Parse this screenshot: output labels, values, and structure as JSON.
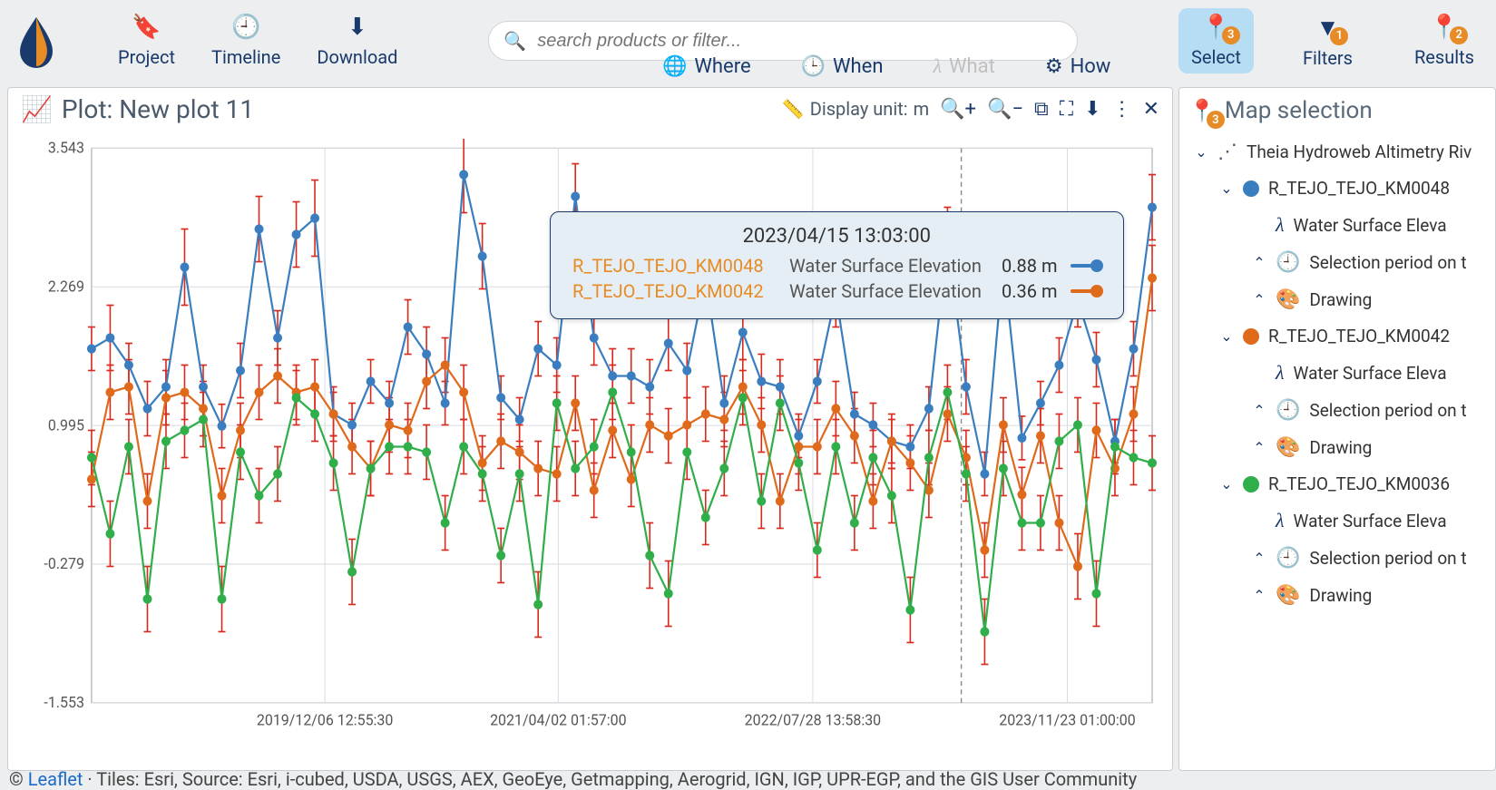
{
  "header": {
    "nav": [
      {
        "icon": "bookmark",
        "label": "Project"
      },
      {
        "icon": "clock",
        "label": "Timeline"
      },
      {
        "icon": "download",
        "label": "Download"
      }
    ],
    "search_placeholder": "search products or filter...",
    "tabs": [
      {
        "icon": "globe",
        "label": "Where",
        "active": true
      },
      {
        "icon": "clock",
        "label": "When",
        "active": true
      },
      {
        "icon": "lambda",
        "label": "What",
        "active": false
      },
      {
        "icon": "sliders",
        "label": "How",
        "active": true
      }
    ],
    "right": [
      {
        "icon": "markers",
        "label": "Select",
        "badge": 3,
        "active": true
      },
      {
        "icon": "funnel",
        "label": "Filters",
        "badge": 1
      },
      {
        "icon": "pin",
        "label": "Results",
        "badge": 2
      }
    ]
  },
  "plot": {
    "title": "Plot: New plot 11",
    "unit_label": "Display unit:",
    "unit_value": "m",
    "actions": [
      "zoom-in",
      "zoom-out",
      "crop",
      "scan",
      "download",
      "more",
      "close"
    ],
    "yticks": [
      -1.553,
      -0.279,
      0.995,
      2.269,
      3.543
    ],
    "xticks": [
      "2019/12/06 12:55:30",
      "2021/04/02 01:57:00",
      "2022/07/28 13:58:30",
      "2023/11/23 01:00:00"
    ],
    "tooltip": {
      "timestamp": "2023/04/15 13:03:00",
      "rows": [
        {
          "series": "R_TEJO_TEJO_KM0048",
          "var": "Water Surface Elevation",
          "value": "0.88",
          "unit": "m",
          "color": "#3b7ebf"
        },
        {
          "series": "R_TEJO_TEJO_KM0042",
          "var": "Water Surface Elevation",
          "value": "0.36",
          "unit": "m",
          "color": "#e06a1b"
        }
      ]
    }
  },
  "sidebar": {
    "title": "Map selection",
    "badge": 3,
    "tree": {
      "group": "Theia Hydroweb Altimetry Riv",
      "items": [
        {
          "name": "R_TEJO_TEJO_KM0048",
          "color": "#3b7ebf",
          "children": [
            "Water Surface Eleva",
            "Selection period on t",
            "Drawing"
          ]
        },
        {
          "name": "R_TEJO_TEJO_KM0042",
          "color": "#e06a1b",
          "children": [
            "Water Surface Eleva",
            "Selection period on t",
            "Drawing"
          ]
        },
        {
          "name": "R_TEJO_TEJO_KM0036",
          "color": "#2fae4a",
          "children": [
            "Water Surface Eleva",
            "Selection period on t",
            "Drawing"
          ]
        }
      ]
    }
  },
  "footer": {
    "link": "Leaflet",
    "text": " · Tiles: Esri, Source: Esri, i-cubed, USDA, USGS, AEX, GeoEye, Getmapping, Aerogrid, IGN, IGP, UPR-EGP, and the GIS User Community"
  },
  "chart_data": {
    "type": "line",
    "xlabel": "",
    "ylabel": "",
    "ylim": [
      -1.553,
      3.543
    ],
    "x_range": [
      "2019/06/01",
      "2024/03/01"
    ],
    "hover_x": "2023/04/15 13:03:00",
    "colors": {
      "R_TEJO_TEJO_KM0048": "#3b7ebf",
      "R_TEJO_TEJO_KM0042": "#e06a1b",
      "R_TEJO_TEJO_KM0036": "#2fae4a",
      "errorbar": "#d9291c"
    },
    "series": [
      {
        "name": "R_TEJO_TEJO_KM0048",
        "variable": "Water Surface Elevation",
        "unit": "m",
        "color": "#3b7ebf",
        "values": [
          1.7,
          1.8,
          1.55,
          1.15,
          1.35,
          2.45,
          1.35,
          0.99,
          1.5,
          2.8,
          1.8,
          2.75,
          2.9,
          1.1,
          1.0,
          1.4,
          1.2,
          1.9,
          1.65,
          1.2,
          3.3,
          2.55,
          1.25,
          1.05,
          1.7,
          1.55,
          3.1,
          1.8,
          1.45,
          1.45,
          1.35,
          1.75,
          1.5,
          2.35,
          1.2,
          1.85,
          1.4,
          1.35,
          0.9,
          1.4,
          2.2,
          1.1,
          1.0,
          0.85,
          0.8,
          1.15,
          2.7,
          1.35,
          0.55,
          2.5,
          0.88,
          1.2,
          1.55,
          2.15,
          1.6,
          0.85,
          1.7,
          3.0
        ],
        "error": [
          0.2,
          0.3,
          0.2,
          0.25,
          0.25,
          0.35,
          0.2,
          0.2,
          0.25,
          0.3,
          0.25,
          0.3,
          0.35,
          0.2,
          0.2,
          0.2,
          0.2,
          0.25,
          0.25,
          0.2,
          0.35,
          0.3,
          0.2,
          0.2,
          0.25,
          0.25,
          0.3,
          0.25,
          0.25,
          0.25,
          0.25,
          0.25,
          0.25,
          0.3,
          0.25,
          0.25,
          0.25,
          0.25,
          0.2,
          0.2,
          0.3,
          0.2,
          0.2,
          0.2,
          0.2,
          0.2,
          0.3,
          0.25,
          0.2,
          0.3,
          0.2,
          0.2,
          0.25,
          0.25,
          0.25,
          0.2,
          0.25,
          0.3
        ]
      },
      {
        "name": "R_TEJO_TEJO_KM0042",
        "variable": "Water Surface Elevation",
        "unit": "m",
        "color": "#e06a1b",
        "values": [
          0.5,
          1.3,
          1.35,
          0.3,
          1.25,
          1.3,
          1.15,
          0.35,
          0.95,
          1.3,
          1.45,
          1.3,
          1.35,
          1.1,
          0.8,
          0.6,
          1.0,
          0.95,
          1.4,
          1.55,
          1.3,
          0.65,
          0.85,
          0.75,
          0.6,
          0.55,
          1.2,
          0.4,
          0.95,
          0.5,
          1.0,
          0.9,
          1.0,
          1.1,
          1.05,
          1.35,
          1.0,
          0.3,
          0.8,
          0.8,
          1.15,
          0.9,
          0.3,
          0.85,
          0.65,
          0.4,
          1.1,
          0.7,
          -0.15,
          1.0,
          0.36,
          0.9,
          0.1,
          -0.3,
          0.95,
          0.6,
          1.1,
          2.35
        ],
        "error": [
          0.25,
          0.25,
          0.25,
          0.25,
          0.25,
          0.25,
          0.25,
          0.25,
          0.25,
          0.25,
          0.25,
          0.25,
          0.25,
          0.25,
          0.25,
          0.25,
          0.25,
          0.25,
          0.25,
          0.25,
          0.25,
          0.25,
          0.25,
          0.25,
          0.25,
          0.25,
          0.25,
          0.25,
          0.25,
          0.25,
          0.25,
          0.25,
          0.25,
          0.25,
          0.25,
          0.25,
          0.25,
          0.25,
          0.25,
          0.25,
          0.25,
          0.25,
          0.25,
          0.25,
          0.25,
          0.25,
          0.25,
          0.25,
          0.25,
          0.25,
          0.25,
          0.25,
          0.25,
          0.3,
          0.25,
          0.25,
          0.25,
          0.3
        ]
      },
      {
        "name": "R_TEJO_TEJO_KM0036",
        "variable": "Water Surface Elevation",
        "unit": "m",
        "color": "#2fae4a",
        "values": [
          0.7,
          0.0,
          0.8,
          -0.6,
          0.85,
          0.95,
          1.05,
          -0.6,
          0.75,
          0.35,
          0.55,
          1.25,
          1.1,
          0.65,
          -0.35,
          0.6,
          0.8,
          0.8,
          0.75,
          0.1,
          0.8,
          0.55,
          -0.2,
          0.55,
          -0.65,
          1.2,
          0.6,
          0.8,
          1.3,
          0.75,
          -0.2,
          -0.55,
          0.75,
          0.15,
          0.6,
          1.25,
          0.3,
          1.2,
          0.65,
          -0.15,
          0.8,
          0.1,
          0.7,
          0.35,
          -0.7,
          0.7,
          1.3,
          0.55,
          -0.9,
          0.6,
          0.1,
          0.1,
          0.85,
          1.0,
          -0.55,
          0.8,
          0.7,
          0.65
        ],
        "error": [
          0.25,
          0.3,
          0.25,
          0.3,
          0.25,
          0.25,
          0.25,
          0.3,
          0.25,
          0.25,
          0.25,
          0.25,
          0.25,
          0.25,
          0.3,
          0.25,
          0.25,
          0.25,
          0.25,
          0.25,
          0.25,
          0.25,
          0.25,
          0.25,
          0.3,
          0.25,
          0.25,
          0.25,
          0.25,
          0.25,
          0.3,
          0.3,
          0.25,
          0.25,
          0.25,
          0.25,
          0.25,
          0.25,
          0.25,
          0.25,
          0.25,
          0.25,
          0.25,
          0.25,
          0.3,
          0.25,
          0.25,
          0.25,
          0.3,
          0.25,
          0.25,
          0.25,
          0.25,
          0.25,
          0.3,
          0.25,
          0.25,
          0.25
        ]
      }
    ]
  }
}
